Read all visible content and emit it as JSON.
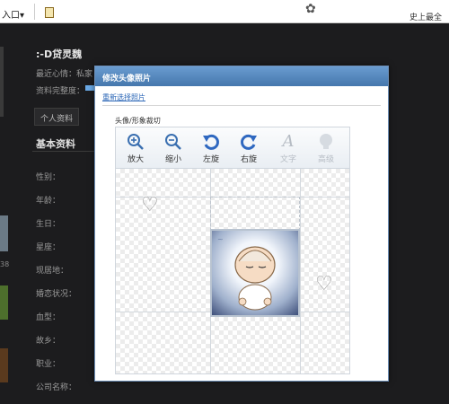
{
  "topbar": {
    "left_menu": "入口▾",
    "tagline": "史上最全"
  },
  "profile": {
    "name": ":-D贷灵魏",
    "mood_label": "最近心情：私家",
    "completion_label": "资料完整度：",
    "tabs": [
      "个人资料"
    ],
    "section_title": "基本资料",
    "fields": [
      "性别：",
      "年龄：",
      "生日：",
      "星座：",
      "现居地：",
      "婚恋状况：",
      "血型：",
      "故乡：",
      "职业：",
      "公司名称："
    ],
    "side_num": "38"
  },
  "modal": {
    "title": "修改头像照片",
    "reselect_link": "重新选择照片",
    "crop_label": "头像/形象裁切",
    "tools": [
      {
        "label": "放大",
        "icon": "zoom-in-icon",
        "enabled": true
      },
      {
        "label": "缩小",
        "icon": "zoom-out-icon",
        "enabled": true
      },
      {
        "label": "左旋",
        "icon": "rotate-left-icon",
        "enabled": true
      },
      {
        "label": "右旋",
        "icon": "rotate-right-icon",
        "enabled": true
      },
      {
        "label": "文字",
        "icon": "text-icon",
        "enabled": false
      },
      {
        "label": "高级",
        "icon": "advanced-icon",
        "enabled": false
      }
    ]
  },
  "colors": {
    "modal_title": "#4577ad",
    "accent_blue": "#2f68c0",
    "background": "#1c1c1e"
  }
}
